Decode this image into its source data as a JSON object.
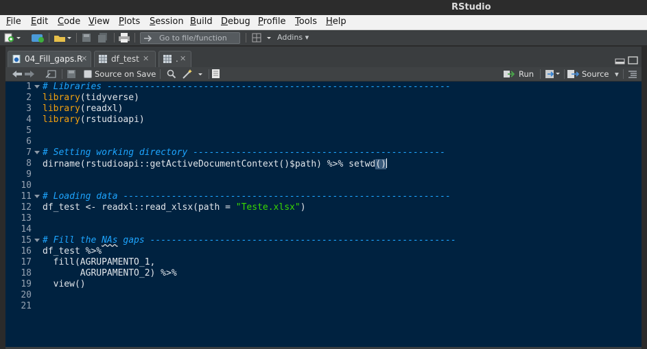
{
  "window": {
    "title": "RStudio"
  },
  "menu": [
    "File",
    "Edit",
    "Code",
    "View",
    "Plots",
    "Session",
    "Build",
    "Debug",
    "Profile",
    "Tools",
    "Help"
  ],
  "toolbar": {
    "goto_placeholder": "Go to file/function",
    "addins_label": "Addins"
  },
  "tabs": [
    {
      "label": "04_Fill_gaps.R",
      "icon": "r-script-icon",
      "active": true
    },
    {
      "label": "df_test",
      "icon": "table-icon",
      "active": false
    },
    {
      "label": ".",
      "icon": "table-icon",
      "active": false
    }
  ],
  "editor_toolbar": {
    "source_on_save": "Source on Save",
    "run": "Run",
    "source": "Source"
  },
  "line_numbers": [
    "1",
    "2",
    "3",
    "4",
    "5",
    "6",
    "7",
    "8",
    "9",
    "10",
    "11",
    "12",
    "13",
    "14",
    "15",
    "16",
    "17",
    "18",
    "19",
    "20",
    "21"
  ],
  "code": {
    "l1_comment": "# Libraries ----------------------------------------------------------------",
    "l2_fn": "library",
    "l2_arg": "(tidyverse)",
    "l3_fn": "library",
    "l3_arg": "(readxl)",
    "l4_fn": "library",
    "l4_arg": "(rstudioapi)",
    "l7_comment": "# Setting working directory -----------------------------------------------",
    "l8_a": "dirname(rstudioapi::getActiveDocumentContext()$path) %>% setwd",
    "l8_b": "(",
    "l8_c": ")",
    "l11_comment": "# Loading data -------------------------------------------------------------",
    "l12_a": "df_test <- readxl::read_xlsx(path = ",
    "l12_str": "\"Teste.xlsx\"",
    "l12_b": ")",
    "l15_a": "# Fill the ",
    "l15_b": "NAs",
    "l15_c": " gaps ---------------------------------------------------------",
    "l16": "df_test %>%",
    "l17": "  fill(AGRUPAMENTO_1,",
    "l18": "       AGRUPAMENTO_2) %>%",
    "l19": "  view()"
  }
}
